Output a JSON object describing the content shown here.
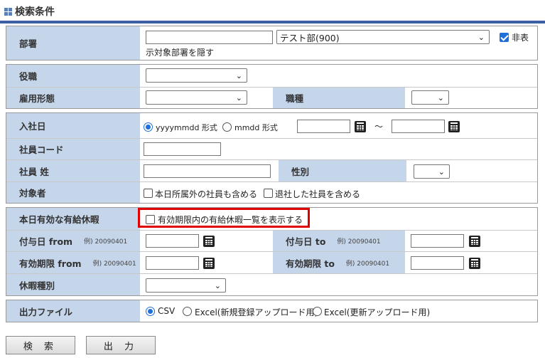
{
  "header": {
    "title": "検索条件"
  },
  "department": {
    "label": "部署",
    "code_value": "",
    "selected": "テスト部(900)",
    "hide_checkbox_label_line1": "非表",
    "hide_checkbox_label_line2": "示対象部署を隠す",
    "hide_checked": true
  },
  "position": {
    "label": "役職",
    "selected": ""
  },
  "employment_type": {
    "label": "雇用形態",
    "selected": ""
  },
  "job_type": {
    "label": "職種",
    "selected": ""
  },
  "hire_date": {
    "label": "入社日",
    "format_option_1": "yyyymmdd 形式",
    "format_option_2": "mmdd 形式",
    "selected_format": "yyyymmdd 形式",
    "from_value": "",
    "to_value": "",
    "separator": "〜"
  },
  "employee_code": {
    "label": "社員コード",
    "value": ""
  },
  "employee_surname": {
    "label": "社員 姓",
    "value": ""
  },
  "gender": {
    "label": "性別",
    "selected": ""
  },
  "target": {
    "label": "対象者",
    "option_other_dept": "本日所属外の社員も含める",
    "option_retired": "退社した社員を含める"
  },
  "paid_leave": {
    "label": "本日有効な有給休暇",
    "option_show_list": "有効期限内の有給休暇一覧を表示する"
  },
  "grant_date_from": {
    "label": "付与日 from",
    "example": "例) 20090401",
    "value": ""
  },
  "grant_date_to": {
    "label": "付与日 to",
    "example": "例) 20090401",
    "value": ""
  },
  "expiry_from": {
    "label": "有効期限 from",
    "example": "例) 20090401",
    "value": ""
  },
  "expiry_to": {
    "label": "有効期限 to",
    "example": "例) 20090401",
    "value": ""
  },
  "leave_type": {
    "label": "休暇種別",
    "selected": ""
  },
  "output_file": {
    "label": "出力ファイル",
    "option_csv": "CSV",
    "option_excel_new": "Excel(新規登録アップロード用)",
    "option_excel_update": "Excel(更新アップロード用)",
    "selected": "CSV"
  },
  "buttons": {
    "search": "検 索",
    "output": "出 力"
  },
  "colors": {
    "label_bg": "#c5d5ea",
    "accent": "#3b5fa0",
    "highlight": "#e00000",
    "check_blue": "#1e6fd9"
  }
}
